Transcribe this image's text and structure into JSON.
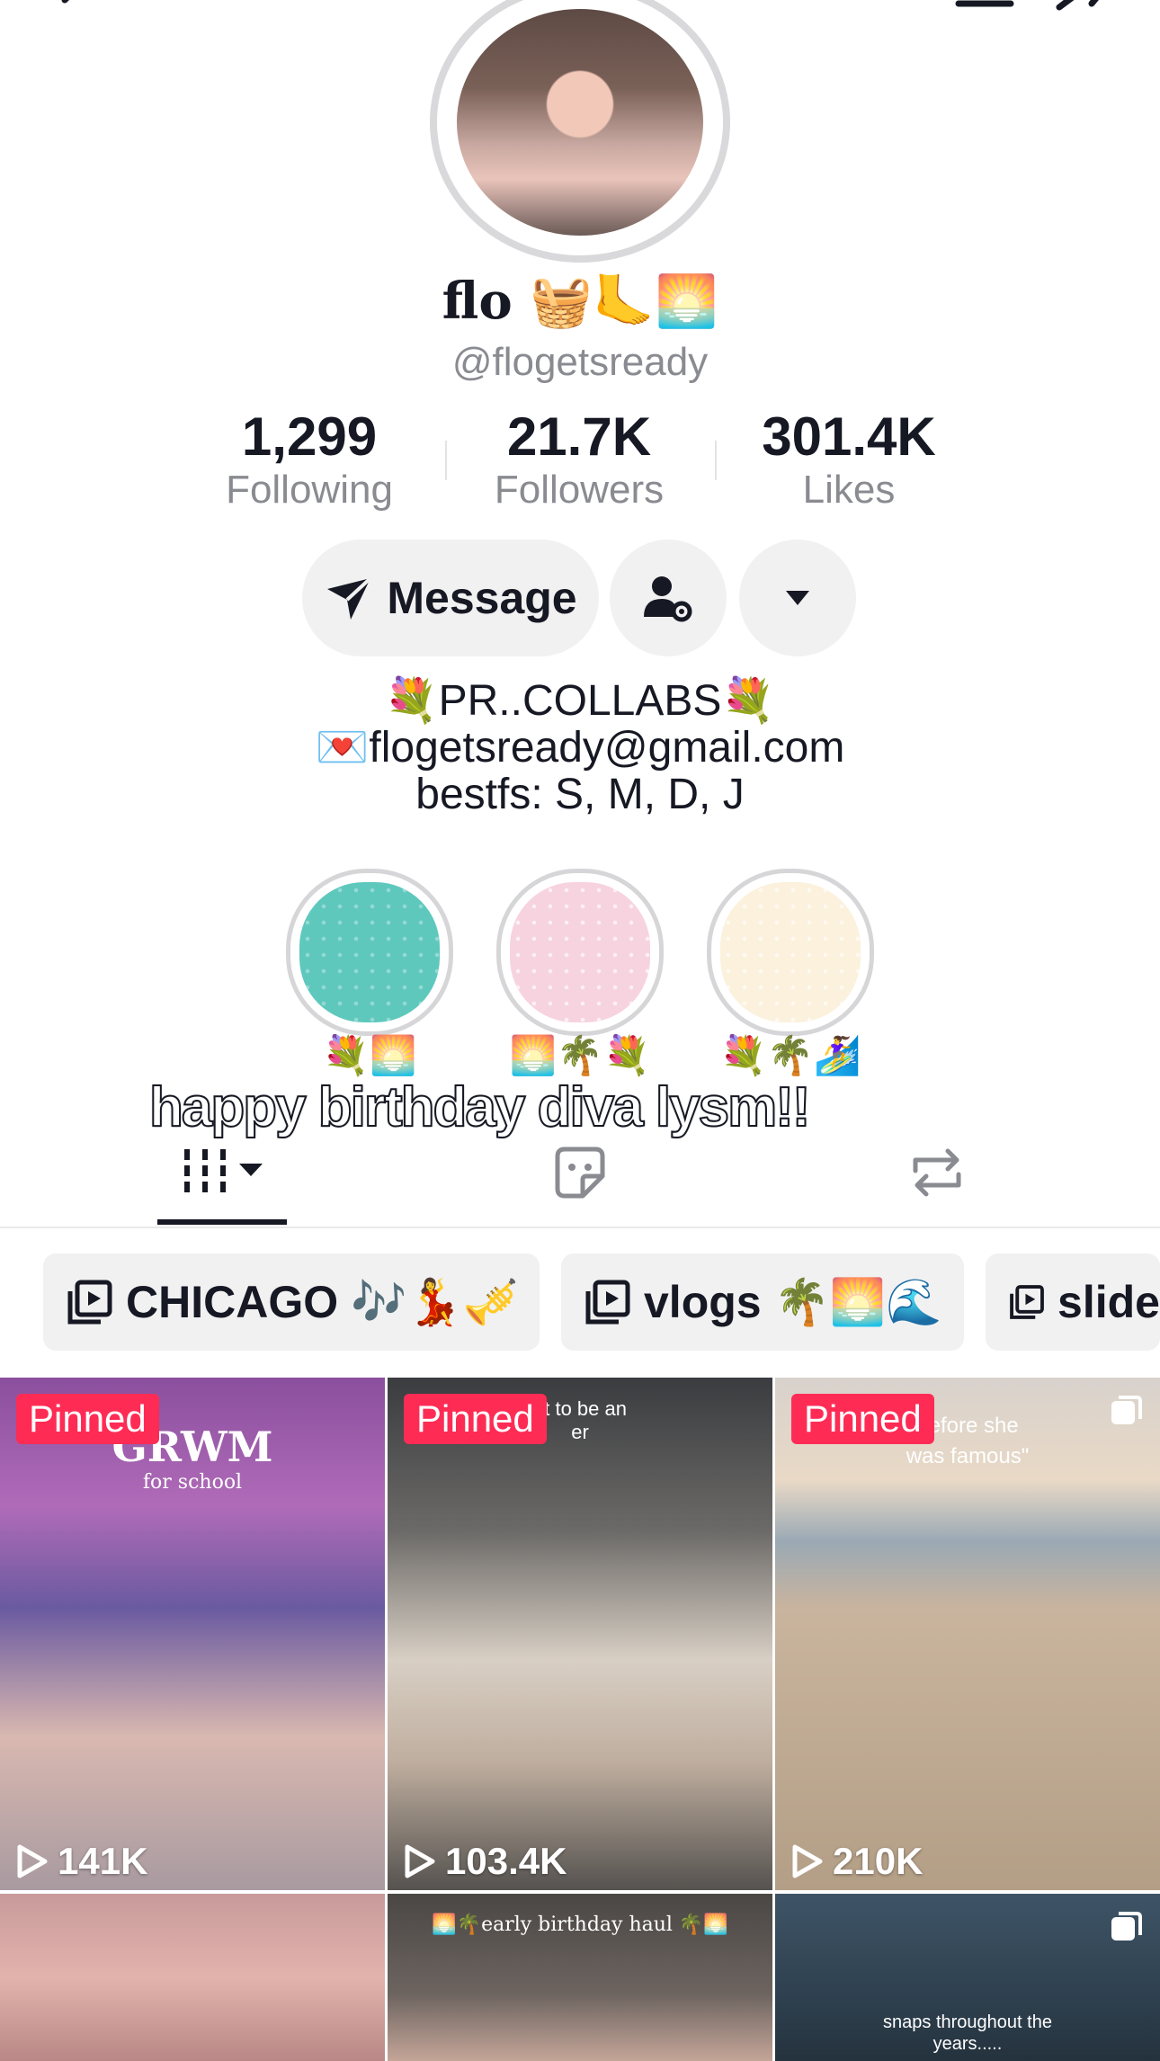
{
  "profile": {
    "display_name": "flo 🧺🦶🌅",
    "handle": "@flogetsready"
  },
  "stats": [
    {
      "value": "1,299",
      "label": "Following"
    },
    {
      "value": "21.7K",
      "label": "Followers"
    },
    {
      "value": "301.4K",
      "label": "Likes"
    }
  ],
  "actions": {
    "message_label": "Message"
  },
  "bio": {
    "line1": "💐PR..COLLABS💐",
    "line2": "💌flogetsready@gmail.com",
    "line3": "bestfs: S, M, D, J"
  },
  "highlights": [
    {
      "label": "💐🌅",
      "color": "#5ec8bd"
    },
    {
      "label": "🌅🌴💐",
      "color": "#f7d3df"
    },
    {
      "label": "💐🌴🏄‍♀️",
      "color": "#fbf1dc"
    }
  ],
  "caption_overlay": "happy birthday diva lysm!!",
  "playlists": [
    {
      "label": "CHICAGO 🎶💃🎺"
    },
    {
      "label": "vlogs 🌴🌅🌊"
    },
    {
      "label": "slide"
    }
  ],
  "videos": [
    {
      "pinned": "Pinned",
      "views": "141K",
      "title": "GRWM",
      "subtitle": "for school"
    },
    {
      "pinned": "Pinned",
      "views": "103.4K",
      "title": "nt to be an",
      "subtitle": "er"
    },
    {
      "pinned": "Pinned",
      "views": "210K",
      "title": "before she",
      "subtitle": "was famous\""
    },
    {
      "title": ""
    },
    {
      "title": "🌅🌴early birthday haul 🌴🌅"
    },
    {
      "title": "snaps throughout the",
      "subtitle": "years....."
    }
  ],
  "colors": {
    "accent": "#fe2c55",
    "text": "#161823",
    "muted": "#8a8b91",
    "button_bg": "#f1f1f2"
  }
}
